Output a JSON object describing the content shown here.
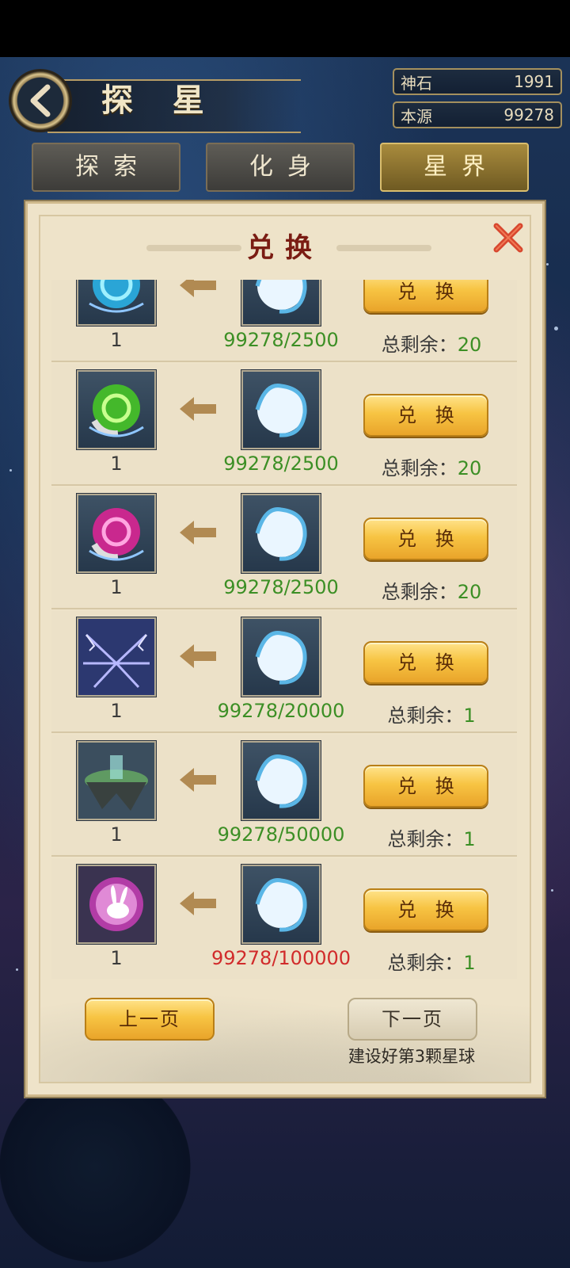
{
  "header": {
    "title": "探 星",
    "resources": [
      {
        "label": "神石",
        "value": "1991"
      },
      {
        "label": "本源",
        "value": "99278"
      }
    ],
    "tabs": [
      {
        "label": "探索",
        "active": false
      },
      {
        "label": "化身",
        "active": false
      },
      {
        "label": "星界",
        "active": true
      }
    ]
  },
  "dialog": {
    "title": "兑换",
    "exchange_label": "兑 换",
    "remain_label": "总剩余：",
    "rows": [
      {
        "item_icon": "cyan-orb-icon",
        "qty": "1",
        "cost": "99278/2500",
        "remain": "20",
        "affordable": true
      },
      {
        "item_icon": "green-orb-icon",
        "qty": "1",
        "cost": "99278/2500",
        "remain": "20",
        "affordable": true
      },
      {
        "item_icon": "magenta-orb-icon",
        "qty": "1",
        "cost": "99278/2500",
        "remain": "20",
        "affordable": true
      },
      {
        "item_icon": "lightning-wings-icon",
        "qty": "1",
        "cost": "99278/20000",
        "remain": "1",
        "affordable": true
      },
      {
        "item_icon": "floating-island-icon",
        "qty": "1",
        "cost": "99278/50000",
        "remain": "1",
        "affordable": true
      },
      {
        "item_icon": "rabbit-emblem-icon",
        "qty": "1",
        "cost": "99278/100000",
        "remain": "1",
        "affordable": false
      }
    ],
    "prev_label": "上一页",
    "next_label": "下一页",
    "hint": "建设好第3颗星球"
  },
  "colors": {
    "cost_ok": "#3c8f25",
    "cost_short": "#d12b2b",
    "title_red": "#7a1c13",
    "gold_button": "#f7c443"
  }
}
